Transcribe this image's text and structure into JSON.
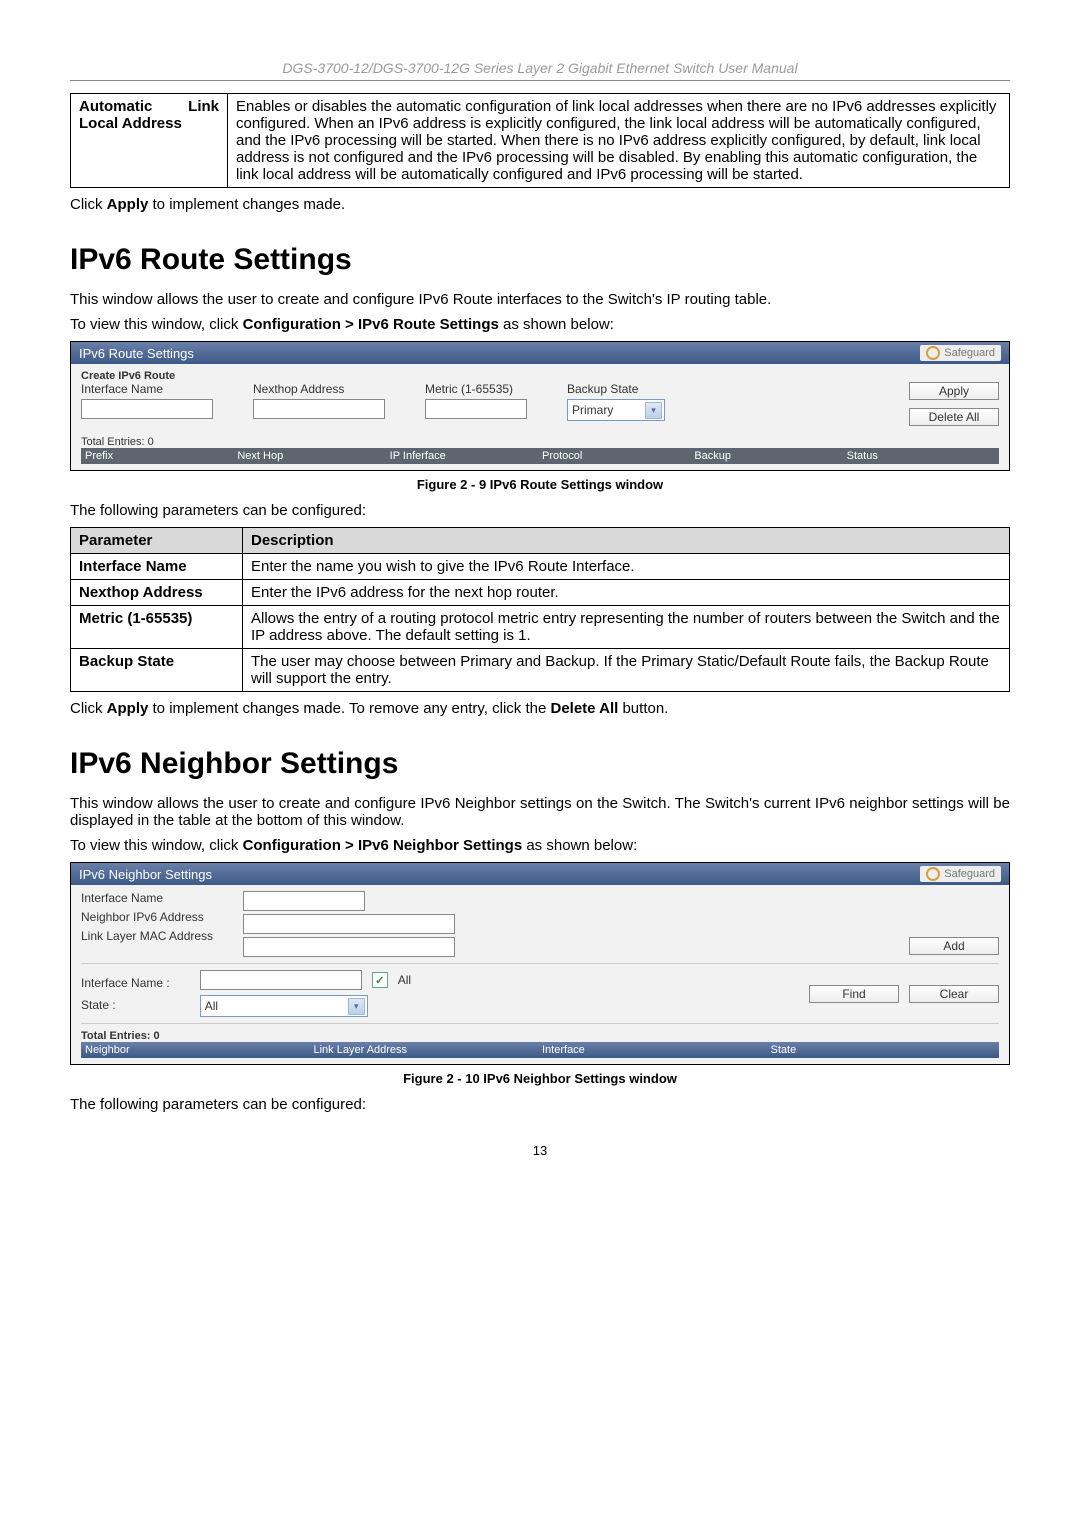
{
  "header": "DGS-3700-12/DGS-3700-12G Series Layer 2 Gigabit Ethernet Switch User Manual",
  "autoLink": {
    "param": "Automatic Link Local Address",
    "desc": "Enables or disables the automatic configuration of link local addresses when there are no IPv6 addresses explicitly configured. When an IPv6 address is explicitly configured, the link local address will be automatically configured, and the IPv6 processing will be started. When there is no IPv6 address explicitly configured, by default, link local address is not configured and the IPv6 processing will be disabled. By enabling this automatic configuration, the link local address will be automatically configured and IPv6 processing will be started."
  },
  "applyNote1_a": "Click ",
  "applyNote1_b": "Apply",
  "applyNote1_c": " to implement changes made.",
  "route": {
    "title": "IPv6 Route Settings",
    "intro": "This window allows the user to create and configure IPv6 Route interfaces to the Switch's IP routing table.",
    "view_a": "To view this window, click ",
    "view_b": "Configuration > IPv6 Route Settings",
    "view_c": " as shown below:",
    "shot": {
      "title": "IPv6 Route Settings",
      "safeguard": "Safeguard",
      "create": "Create IPv6 Route",
      "ifname": "Interface Name",
      "nexthop": "Nexthop Address",
      "metric": "Metric (1-65535)",
      "backup": "Backup State",
      "primary": "Primary",
      "apply": "Apply",
      "deleteAll": "Delete All",
      "total": "Total Entries: 0",
      "cols": [
        "Prefix",
        "Next Hop",
        "IP Inferface",
        "Protocol",
        "Backup",
        "Status"
      ]
    },
    "figcap": "Figure 2 - 9 IPv6 Route Settings window",
    "paramsIntro": "The following parameters can be configured:",
    "table": {
      "h1": "Parameter",
      "h2": "Description",
      "rows": [
        {
          "p": "Interface Name",
          "d": "Enter the name you wish to give the IPv6 Route Interface."
        },
        {
          "p": "Nexthop Address",
          "d": "Enter the IPv6 address for the next hop router."
        },
        {
          "p": "Metric (1-65535)",
          "d": "Allows the entry of a routing protocol metric entry representing the number of routers between the Switch and the IP address above. The default setting is 1."
        },
        {
          "p": "Backup State",
          "d": "The user may choose between Primary and Backup. If the Primary Static/Default Route fails, the Backup Route will support the entry."
        }
      ]
    },
    "applyNote_a": "Click ",
    "applyNote_b": "Apply",
    "applyNote_c": " to implement changes made. To remove any entry, click the ",
    "applyNote_d": "Delete All",
    "applyNote_e": " button."
  },
  "neighbor": {
    "title": "IPv6 Neighbor Settings",
    "intro": "This window allows the user to create and configure IPv6 Neighbor settings on the Switch. The Switch's current IPv6 neighbor settings will be displayed in the table at the bottom of this window.",
    "view_a": "To view this window, click ",
    "view_b": "Configuration > IPv6 Neighbor Settings",
    "view_c": " as shown below:",
    "shot": {
      "title": "IPv6 Neighbor Settings",
      "safeguard": "Safeguard",
      "ifname": "Interface Name",
      "nip": "Neighbor IPv6 Address",
      "mac": "Link Layer MAC Address",
      "add": "Add",
      "ifname2": "Interface Name :",
      "all": "All",
      "state": "State :",
      "stateVal": "All",
      "find": "Find",
      "clear": "Clear",
      "total": "Total Entries: 0",
      "cols": [
        "Neighbor",
        "Link Layer Address",
        "Interface",
        "State"
      ]
    },
    "figcap": "Figure 2 - 10 IPv6 Neighbor Settings window",
    "paramsIntro": "The following parameters can be configured:"
  },
  "pagenum": "13"
}
